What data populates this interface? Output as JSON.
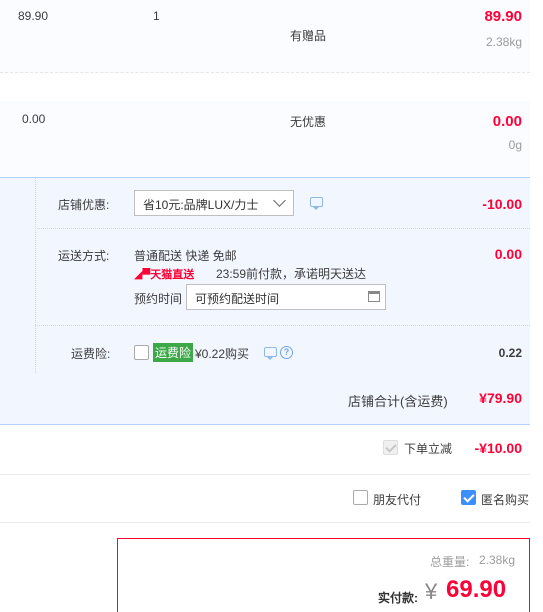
{
  "item1": {
    "price": "89.90",
    "quantity": "1",
    "promo": "有赠品",
    "subtotal": "89.90",
    "weight": "2.38kg"
  },
  "item2": {
    "price": "0.00",
    "promo": "无优惠",
    "subtotal": "0.00",
    "weight": "0g"
  },
  "shop_discount": {
    "label": "店铺优惠:",
    "selected": "省10元:品牌LUX/力士",
    "amount": "-10.00"
  },
  "shipping": {
    "label": "运送方式:",
    "method": "普通配送 快递 免邮",
    "badge": "天猫直送",
    "note": "23:59前付款，承诺明天送达",
    "schedule_label": "预约时间",
    "schedule_placeholder": "可预约配送时间",
    "amount": "0.00"
  },
  "insurance": {
    "label": "运费险:",
    "tag": "运费险",
    "offer": "¥0.22购买",
    "amount": "0.22"
  },
  "shop_total": {
    "label": "店铺合计(含运费)",
    "amount": "¥79.90"
  },
  "order_discount": {
    "label": "下单立减",
    "amount": "-¥10.00"
  },
  "options": {
    "friend_pay": "朋友代付",
    "anonymous": "匿名购买",
    "friend_pay_checked": false,
    "anonymous_checked": true
  },
  "summary": {
    "weight_label": "总重量:",
    "weight": "2.38kg",
    "pay_label": "实付款:",
    "currency": "¥",
    "amount": "69.90"
  },
  "colors": {
    "price_red": "#ff0036",
    "accent_blue": "#3c8fff",
    "promo_bg": "#f2f7ff"
  }
}
